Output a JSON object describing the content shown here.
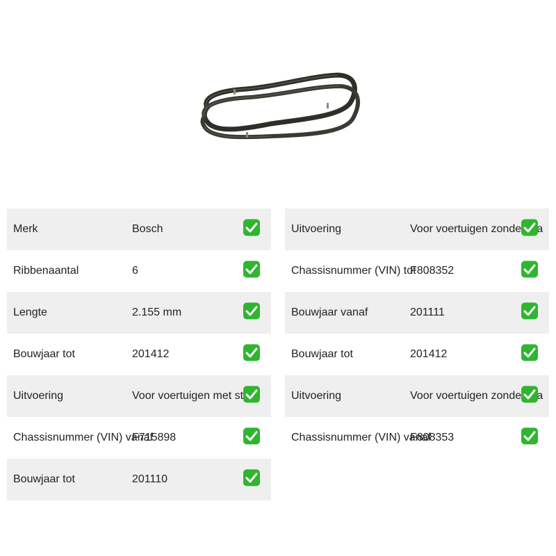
{
  "product": {
    "image_icon": "serpentine-belt-image"
  },
  "left_table": {
    "rows": [
      {
        "label": "Merk",
        "value": "Bosch"
      },
      {
        "label": "Ribbenaantal",
        "value": "6"
      },
      {
        "label": "Lengte",
        "value": "2.155 mm"
      },
      {
        "label": "Bouwjaar tot",
        "value": "201412"
      },
      {
        "label": "Uitvoering",
        "value": "Voor voertuigen met start/"
      },
      {
        "label": "Chassisnummer (VIN) vanaf",
        "value": "F715898"
      },
      {
        "label": "Bouwjaar tot",
        "value": "201110"
      }
    ]
  },
  "right_table": {
    "rows": [
      {
        "label": "Uitvoering",
        "value": "Voor voertuigen zonder sta"
      },
      {
        "label": "Chassisnummer (VIN) tot",
        "value": "F808352"
      },
      {
        "label": "Bouwjaar vanaf",
        "value": "201111"
      },
      {
        "label": "Bouwjaar tot",
        "value": "201412"
      },
      {
        "label": "Uitvoering",
        "value": "Voor voertuigen zonder sta"
      },
      {
        "label": "Chassisnummer (VIN) vanaf",
        "value": "F808353"
      }
    ]
  },
  "colors": {
    "row_shade": "#efefef",
    "check_green": "#2fb52f",
    "belt_dark": "#2f2f2a"
  },
  "icons": {
    "check": "check-mark-icon"
  }
}
